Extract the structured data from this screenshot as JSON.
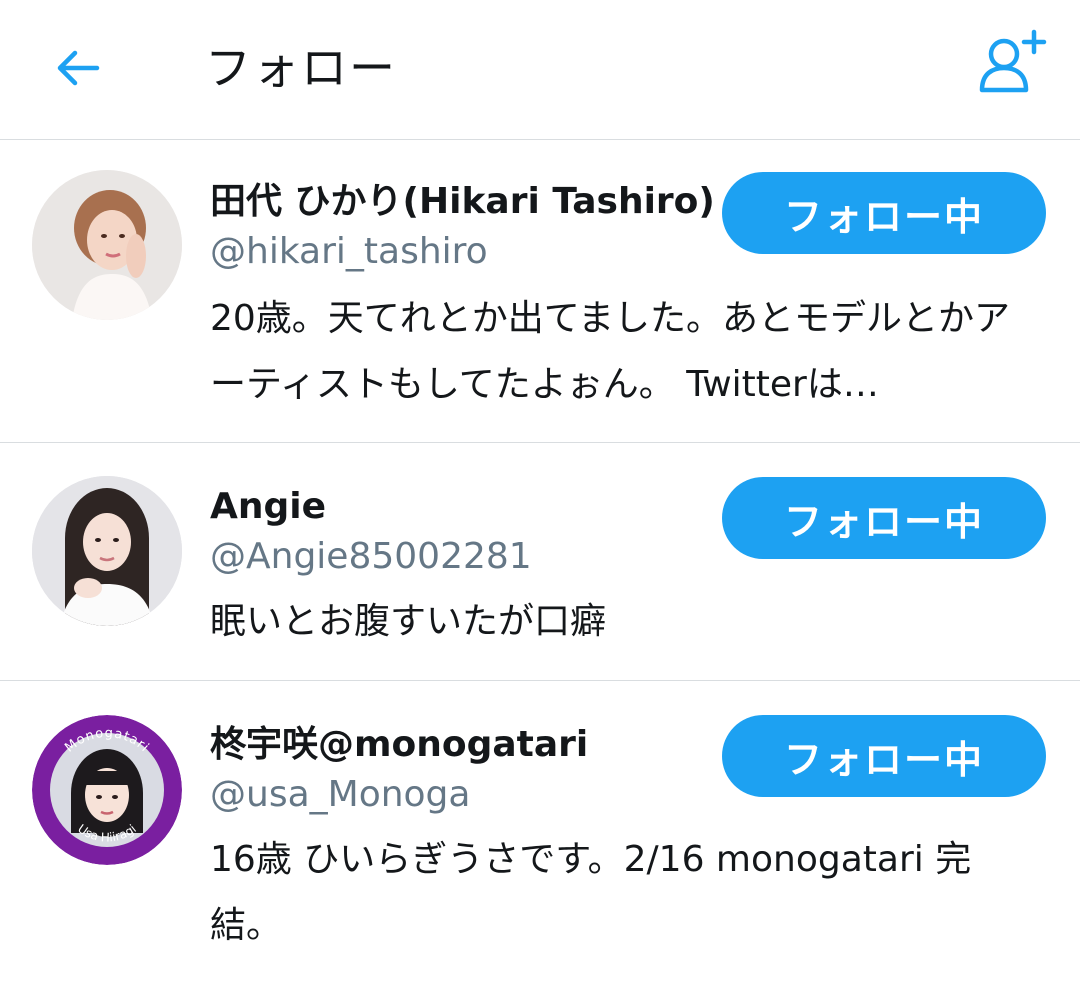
{
  "header": {
    "title": "フォロー",
    "back_icon": "arrow-left-icon",
    "add_icon": "add-user-icon"
  },
  "colors": {
    "accent": "#1da1f2",
    "icon_blue": "#1da1f2",
    "handle": "#657786",
    "divider": "#d9dde0"
  },
  "users": [
    {
      "name": "田代 ひかり(Hikari Tashiro)",
      "handle": "@hikari_tashiro",
      "bio": "20歳。天てれとか出てました。あとモデルとかアーティストもしてたよぉん。 Twitterは…",
      "button": "フォロー中"
    },
    {
      "name": "Angie",
      "handle": "@Angie85002281",
      "bio": "眠いとお腹すいたが口癖",
      "button": "フォロー中"
    },
    {
      "name": "柊宇咲@monogatari",
      "handle": "@usa_Monoga",
      "bio": "16歳 ひいらぎうさです。2/16 monogatari 完結。",
      "button": "フォロー中",
      "avatar_ring_top": "Monogatari",
      "avatar_ring_bottom": "Usa Hiiragi"
    }
  ]
}
